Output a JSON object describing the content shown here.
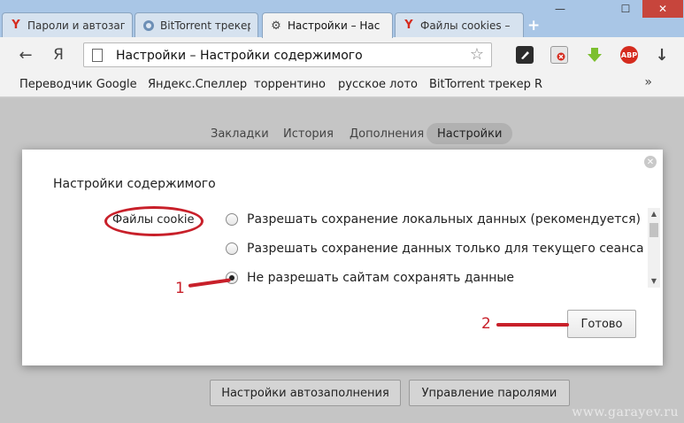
{
  "window": {
    "controls": {
      "minimize": "—",
      "maximize": "☐",
      "close": "✕"
    }
  },
  "tabs": [
    {
      "title": "Пароли и автозап",
      "icon": "yandex-icon",
      "active": false
    },
    {
      "title": "BitTorrent трекер",
      "icon": "torrent-icon",
      "active": false
    },
    {
      "title": "Настройки – Нас",
      "icon": "gear-icon",
      "active": true
    },
    {
      "title": "Файлы cookies –",
      "icon": "yandex-icon",
      "active": false
    }
  ],
  "new_tab": "+",
  "toolbar": {
    "back": "←",
    "yandex_logo": "Я",
    "url": "Настройки – Настройки содержимого",
    "star": "☆",
    "extensions": {
      "abp": "ABP",
      "download": "↓"
    }
  },
  "bookmarks": {
    "items": [
      "Переводчик Google",
      "Яндекс.Спеллер",
      "торрентино",
      "русское лото",
      "BitTorrent трекер Ru"
    ],
    "more": "»"
  },
  "settings_nav": [
    "Закладки",
    "История",
    "Дополнения",
    "Настройки"
  ],
  "dialog": {
    "title": "Настройки содержимого",
    "close": "✕",
    "section_label": "Файлы cookie",
    "options": [
      {
        "label": "Разрешать сохранение локальных данных (рекомендуется)",
        "checked": false
      },
      {
        "label": "Разрешать сохранение данных только для текущего сеанса",
        "checked": false
      },
      {
        "label": "Не разрешать сайтам сохранять данные",
        "checked": true
      }
    ],
    "done_label": "Готово"
  },
  "bottom_buttons": {
    "autofill": "Настройки автозаполнения",
    "passwords": "Управление паролями"
  },
  "annotations": {
    "one": "1",
    "two": "2"
  },
  "watermark": "www.garayev.ru",
  "colors": {
    "annotation_red": "#c8202a",
    "titlebar_blue": "#a9c6e6"
  }
}
